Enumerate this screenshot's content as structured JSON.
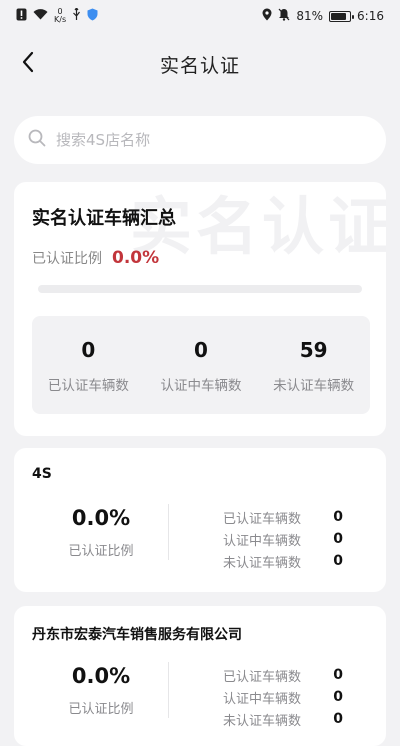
{
  "status_bar": {
    "net_speed_value": "0",
    "net_speed_unit": "K/s",
    "battery_percent": "81%",
    "time": "6:16",
    "battery_level": 0.81
  },
  "navbar": {
    "title": "实名认证"
  },
  "search": {
    "placeholder": "搜索4S店名称",
    "value": ""
  },
  "summary": {
    "watermark": "实名认证",
    "title": "实名认证车辆汇总",
    "ratio_label": "已认证比例",
    "ratio_value": "0.0%",
    "progress": 0.0,
    "stats": [
      {
        "value": "0",
        "label": "已认证车辆数"
      },
      {
        "value": "0",
        "label": "认证中车辆数"
      },
      {
        "value": "59",
        "label": "未认证车辆数"
      }
    ]
  },
  "stores": [
    {
      "name": "4S",
      "ratio": "0.0%",
      "ratio_label": "已认证比例",
      "rows": [
        {
          "label": "已认证车辆数",
          "value": "0"
        },
        {
          "label": "认证中车辆数",
          "value": "0"
        },
        {
          "label": "未认证车辆数",
          "value": "0"
        }
      ]
    },
    {
      "name": "丹东市宏泰汽车销售服务有限公司",
      "ratio": "0.0%",
      "ratio_label": "已认证比例",
      "rows": [
        {
          "label": "已认证车辆数",
          "value": "0"
        },
        {
          "label": "认证中车辆数",
          "value": "0"
        },
        {
          "label": "未认证车辆数",
          "value": "0"
        }
      ]
    }
  ],
  "colors": {
    "accent_red": "#c2353b",
    "background": "#f2f2f4"
  }
}
